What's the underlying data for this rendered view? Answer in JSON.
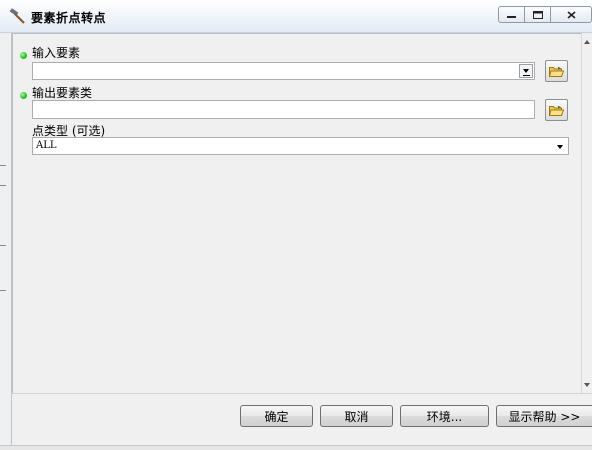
{
  "window": {
    "title": "要素折点转点",
    "icon": "hammer-icon",
    "controls": {
      "minimize": "minimize-icon",
      "maximize": "maximize-icon",
      "close": "close-icon"
    }
  },
  "form": {
    "input_features": {
      "label": "输入要素",
      "value": "",
      "required": true
    },
    "output_features": {
      "label": "输出要素类",
      "value": "",
      "required": true
    },
    "point_type": {
      "label": "点类型 (可选)",
      "value": "ALL"
    }
  },
  "buttons": {
    "ok": "确定",
    "cancel": "取消",
    "environments": "环境...",
    "show_help": "显示帮助 >>"
  },
  "colors": {
    "required_dot": "#13b013",
    "panel_bg": "#f0f0f0",
    "field_border": "#abadb3"
  }
}
